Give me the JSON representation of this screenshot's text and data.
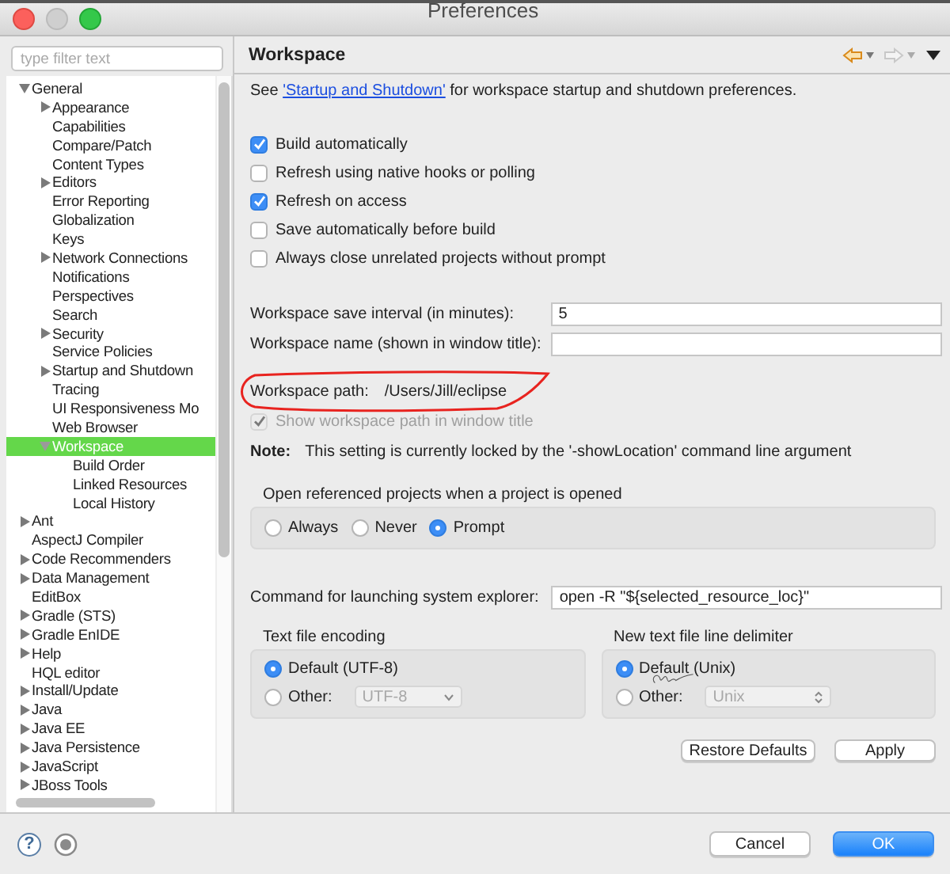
{
  "window": {
    "title": "Preferences"
  },
  "sidebar": {
    "filter": {
      "placeholder": "type filter text"
    },
    "tree": [
      {
        "label": "General",
        "kind": "branch",
        "expanded": true,
        "selected": false,
        "children": [
          {
            "label": "Appearance",
            "kind": "branch",
            "expanded": false,
            "selected": false
          },
          {
            "label": "Capabilities",
            "kind": "leaf",
            "expanded": false,
            "selected": false
          },
          {
            "label": "Compare/Patch",
            "kind": "leaf",
            "expanded": false,
            "selected": false
          },
          {
            "label": "Content Types",
            "kind": "leaf",
            "expanded": false,
            "selected": false
          },
          {
            "label": "Editors",
            "kind": "branch",
            "expanded": false,
            "selected": false
          },
          {
            "label": "Error Reporting",
            "kind": "leaf",
            "expanded": false,
            "selected": false
          },
          {
            "label": "Globalization",
            "kind": "leaf",
            "expanded": false,
            "selected": false
          },
          {
            "label": "Keys",
            "kind": "leaf",
            "expanded": false,
            "selected": false
          },
          {
            "label": "Network Connections",
            "kind": "branch",
            "expanded": false,
            "selected": false
          },
          {
            "label": "Notifications",
            "kind": "leaf",
            "expanded": false,
            "selected": false
          },
          {
            "label": "Perspectives",
            "kind": "leaf",
            "expanded": false,
            "selected": false
          },
          {
            "label": "Search",
            "kind": "leaf",
            "expanded": false,
            "selected": false
          },
          {
            "label": "Security",
            "kind": "branch",
            "expanded": false,
            "selected": false
          },
          {
            "label": "Service Policies",
            "kind": "leaf",
            "expanded": false,
            "selected": false
          },
          {
            "label": "Startup and Shutdown",
            "kind": "branch",
            "expanded": false,
            "selected": false
          },
          {
            "label": "Tracing",
            "kind": "leaf",
            "expanded": false,
            "selected": false
          },
          {
            "label": "UI Responsiveness Mo",
            "kind": "leaf",
            "expanded": false,
            "selected": false
          },
          {
            "label": "Web Browser",
            "kind": "leaf",
            "expanded": false,
            "selected": false
          },
          {
            "label": "Workspace",
            "kind": "branch",
            "expanded": true,
            "selected": true,
            "children": [
              {
                "label": "Build Order",
                "kind": "leaf",
                "expanded": false,
                "selected": false
              },
              {
                "label": "Linked Resources",
                "kind": "leaf",
                "expanded": false,
                "selected": false
              },
              {
                "label": "Local History",
                "kind": "leaf",
                "expanded": false,
                "selected": false
              }
            ]
          }
        ]
      },
      {
        "label": "Ant",
        "kind": "branch",
        "expanded": false,
        "selected": false
      },
      {
        "label": "AspectJ Compiler",
        "kind": "leaf",
        "expanded": false,
        "selected": false
      },
      {
        "label": "Code Recommenders",
        "kind": "branch",
        "expanded": false,
        "selected": false
      },
      {
        "label": "Data Management",
        "kind": "branch",
        "expanded": false,
        "selected": false
      },
      {
        "label": "EditBox",
        "kind": "leaf",
        "expanded": false,
        "selected": false
      },
      {
        "label": "Gradle (STS)",
        "kind": "branch",
        "expanded": false,
        "selected": false
      },
      {
        "label": "Gradle EnIDE",
        "kind": "branch",
        "expanded": false,
        "selected": false
      },
      {
        "label": "Help",
        "kind": "branch",
        "expanded": false,
        "selected": false
      },
      {
        "label": "HQL editor",
        "kind": "leaf",
        "expanded": false,
        "selected": false
      },
      {
        "label": "Install/Update",
        "kind": "branch",
        "expanded": false,
        "selected": false
      },
      {
        "label": "Java",
        "kind": "branch",
        "expanded": false,
        "selected": false
      },
      {
        "label": "Java EE",
        "kind": "branch",
        "expanded": false,
        "selected": false
      },
      {
        "label": "Java Persistence",
        "kind": "branch",
        "expanded": false,
        "selected": false
      },
      {
        "label": "JavaScript",
        "kind": "branch",
        "expanded": false,
        "selected": false
      },
      {
        "label": "JBoss Tools",
        "kind": "branch",
        "expanded": false,
        "selected": false
      }
    ]
  },
  "page": {
    "title": "Workspace",
    "intro": {
      "before": "See ",
      "link": "'Startup and Shutdown'",
      "after": " for workspace startup and shutdown preferences."
    },
    "options": [
      {
        "label": "Build automatically",
        "checked": true
      },
      {
        "label": "Refresh using native hooks or polling",
        "checked": false
      },
      {
        "label": "Refresh on access",
        "checked": true
      },
      {
        "label": "Save automatically before build",
        "checked": false
      },
      {
        "label": "Always close unrelated projects without prompt",
        "checked": false
      }
    ],
    "fields": [
      {
        "label": "Workspace save interval (in minutes):",
        "value": "5"
      },
      {
        "label": "Workspace name (shown in window title):"
      }
    ],
    "path": {
      "label": "Workspace path:",
      "value": "/Users/Jill/eclipse"
    },
    "show_path": {
      "label": "Show workspace path in window title",
      "checked": true,
      "disabled": true
    },
    "note": {
      "label": "Note:",
      "text": "This setting is currently locked by the '-showLocation' command line argument"
    },
    "open_projects": {
      "title": "Open referenced projects when a project is opened",
      "options": [
        {
          "label": "Always",
          "selected": false
        },
        {
          "label": "Never",
          "selected": false
        },
        {
          "label": "Prompt",
          "selected": true
        }
      ]
    },
    "command": {
      "label": "Command for launching system explorer:",
      "value": "open -R \"${selected_resource_loc}\""
    },
    "encoding": {
      "title": "Text file encoding",
      "options": [
        {
          "label": "Default (UTF-8)",
          "selected": true
        },
        {
          "label": "Other:",
          "selected": false
        }
      ],
      "select": {
        "value": "UTF-8",
        "disabled": true
      }
    },
    "delimiter": {
      "title": "New text file line delimiter",
      "options": [
        {
          "label": "Default (Unix)",
          "selected": true
        },
        {
          "label": "Other:",
          "selected": false
        }
      ],
      "select": {
        "value": "Unix",
        "disabled": true
      }
    },
    "buttons": [
      "Restore Defaults",
      "Apply"
    ]
  },
  "footer": {
    "help": "?",
    "buttons": [
      {
        "label": "Cancel",
        "kind": "default"
      },
      {
        "label": "OK",
        "kind": "primary"
      }
    ]
  }
}
